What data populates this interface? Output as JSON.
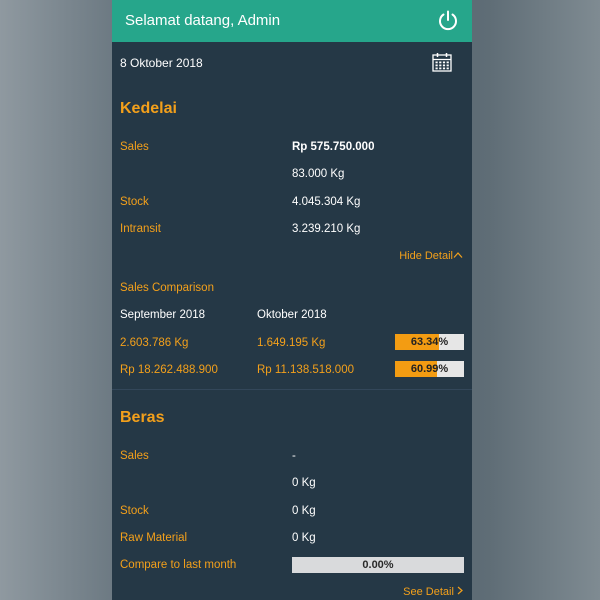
{
  "header": {
    "title": "Selamat datang, Admin",
    "power_icon": "power-icon"
  },
  "date": {
    "text": "8 Oktober 2018",
    "calendar_icon": "calendar-icon"
  },
  "kedelai": {
    "title": "Kedelai",
    "sales_label": "Sales",
    "sales_value": "Rp 575.750.000",
    "sales_qty": "83.000 Kg",
    "stock_label": "Stock",
    "stock_value": "4.045.304 Kg",
    "intransit_label": "Intransit",
    "intransit_value": "3.239.210 Kg",
    "hide_detail": "Hide Detail",
    "comparison_title": "Sales Comparison",
    "prev_month": "September 2018",
    "curr_month": "Oktober 2018",
    "prev_qty": "2.603.786 Kg",
    "curr_qty": "1.649.195 Kg",
    "qty_pct_label": "63.34%",
    "qty_pct": 0.6334,
    "prev_amount": "Rp 18.262.488.900",
    "curr_amount": "Rp 11.138.518.000",
    "amount_pct_label": "60.99%",
    "amount_pct": 0.6099
  },
  "beras": {
    "title": "Beras",
    "sales_label": "Sales",
    "sales_value": "-",
    "sales_qty": "0 Kg",
    "stock_label": "Stock",
    "stock_value": "0 Kg",
    "raw_label": "Raw Material",
    "raw_value": "0 Kg",
    "compare_label": "Compare to last month",
    "compare_pct_label": "0.00%",
    "compare_pct": 0,
    "see_detail": "See Detail"
  },
  "colors": {
    "header": "#26a68b",
    "panel": "#253846",
    "accent": "#f3a01b"
  }
}
